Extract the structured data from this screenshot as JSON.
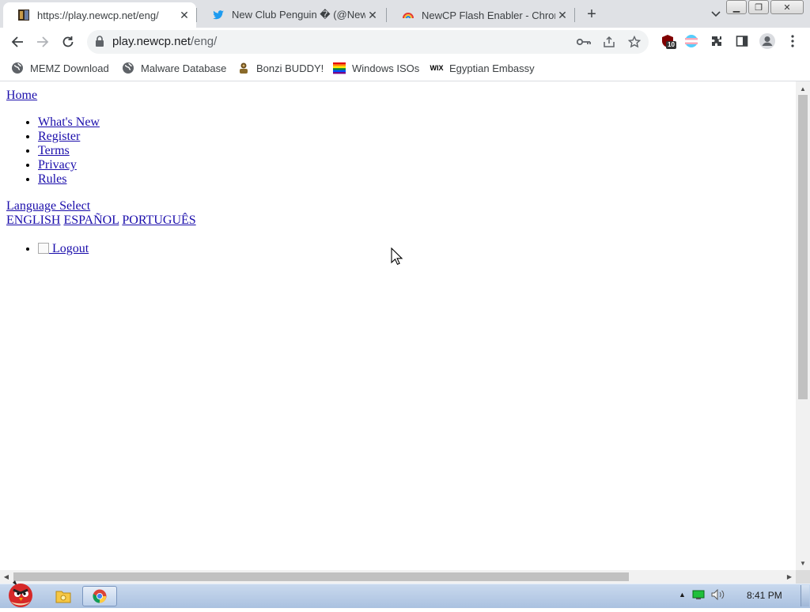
{
  "tabs": [
    {
      "title": "https://play.newcp.net/eng/",
      "icon": "penguin-favicon",
      "active": true
    },
    {
      "title": "New Club Penguin � (@NewC",
      "icon": "twitter-bird-icon",
      "active": false
    },
    {
      "title": "NewCP Flash Enabler - Chrom",
      "icon": "rainbow-extension-icon",
      "active": false
    }
  ],
  "toolbar": {
    "url_host": "play.newcp.net",
    "url_path": "/eng/",
    "extension_badge": "10"
  },
  "bookmarks": [
    {
      "label": "MEMZ Download",
      "icon": "globe-icon"
    },
    {
      "label": "Malware Database",
      "icon": "globe-icon"
    },
    {
      "label": "Bonzi BUDDY!",
      "icon": "bonzi-icon"
    },
    {
      "label": "Windows ISOs",
      "icon": "rainbow-flag-icon"
    },
    {
      "label": "Egyptian Embassy",
      "icon": "wix-icon"
    }
  ],
  "page": {
    "home": "Home",
    "nav": [
      "What's New",
      "Register",
      "Terms",
      "Privacy",
      "Rules"
    ],
    "language_select": "Language Select",
    "languages": [
      "ENGLISH",
      "ESPAÑOL",
      "PORTUGUÊS"
    ],
    "logout": "Logout"
  },
  "taskbar": {
    "clock": "8:41 PM"
  },
  "colors": {
    "link": "#1a0dab",
    "tabstrip_bg": "#dfe1e5",
    "omnibox_bg": "#f1f3f4",
    "taskbar_bg": "#aac1e0"
  }
}
